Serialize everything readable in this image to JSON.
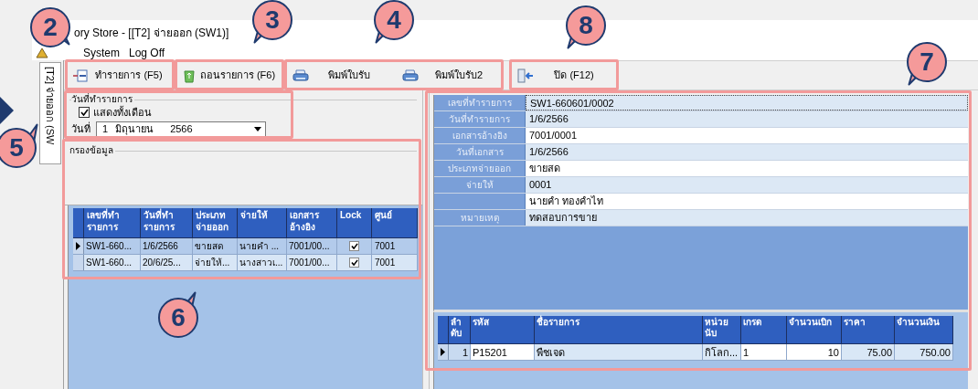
{
  "window": {
    "title": "ory Store - [[T2] จ่ายออก (SW1)]"
  },
  "menu": [
    "System",
    "Log Off"
  ],
  "tab": {
    "label": "[T2] จ่ายออก (SW",
    "selected": true
  },
  "toolbar": [
    {
      "kind": "add",
      "label": "ทำรายการ (F5)"
    },
    {
      "kind": "remove",
      "label": "ถอนรายการ (F6)"
    },
    {
      "kind": "print",
      "label": "พิมพ์ใบรับ"
    },
    {
      "kind": "print",
      "label": "พิมพ์ใบรับ2"
    },
    {
      "kind": "close",
      "label": "ปิด (F12)"
    }
  ],
  "date_group": {
    "title": "วันที่ทำรายการ",
    "show_month": {
      "label": "แสดงทั้งเดือน",
      "checked": true
    },
    "date_label": "วันที่",
    "day": "1",
    "month": "มิถุนายน",
    "year": "2566"
  },
  "filter_group": {
    "title": "กรองข้อมูล"
  },
  "list": {
    "columns": [
      "เลขที่ทำ รายการ",
      "วันที่ทำ รายการ",
      "ประเภท จ่ายออก",
      "จ่ายให้",
      "เอกสาร อ้างอิง",
      "Lock",
      "ศูนย์"
    ],
    "rows": [
      {
        "selected": true,
        "cells": [
          "SW1-660...",
          "1/6/2566",
          "ขายสด",
          "นายคำ ...",
          "7001/00...",
          "7001"
        ],
        "lock": true
      },
      {
        "selected": false,
        "cells": [
          "SW1-660...",
          "20/6/25...",
          "จ่ายให้...",
          "นางสาวเ...",
          "7001/00...",
          "7001"
        ],
        "lock": true
      }
    ]
  },
  "details": [
    {
      "label": "เลขที่ทำรายการ",
      "value": "SW1-660601/0002"
    },
    {
      "label": "วันที่ทำรายการ",
      "value": "1/6/2566"
    },
    {
      "label": "เอกสารอ้างอิง",
      "value": "7001/0001"
    },
    {
      "label": "วันที่เอกสาร",
      "value": "1/6/2566"
    },
    {
      "label": "ประเภทจ่ายออก",
      "value": "ขายสด"
    },
    {
      "label": "จ่ายให้",
      "value": "0001"
    },
    {
      "value": "นายคำ ทองคำไท"
    },
    {
      "label": "หมายเหตุ",
      "value": "ทดสอบการขาย"
    }
  ],
  "items": {
    "columns": [
      "ลำ ดับ",
      "รหัส",
      "ชื่อรายการ",
      "หน่วย นับ",
      "เกรด",
      "จำนวนเบิก",
      "ราคา",
      "จำนวนเงิน"
    ],
    "rows": [
      {
        "selected": true,
        "cells": [
          "1",
          "P15201",
          "พืชเจด",
          "กิโลก...",
          "1",
          "10",
          "75.00",
          "750.00"
        ]
      }
    ]
  },
  "callouts": [
    "2",
    "3",
    "4",
    "5",
    "6",
    "7",
    "8"
  ]
}
